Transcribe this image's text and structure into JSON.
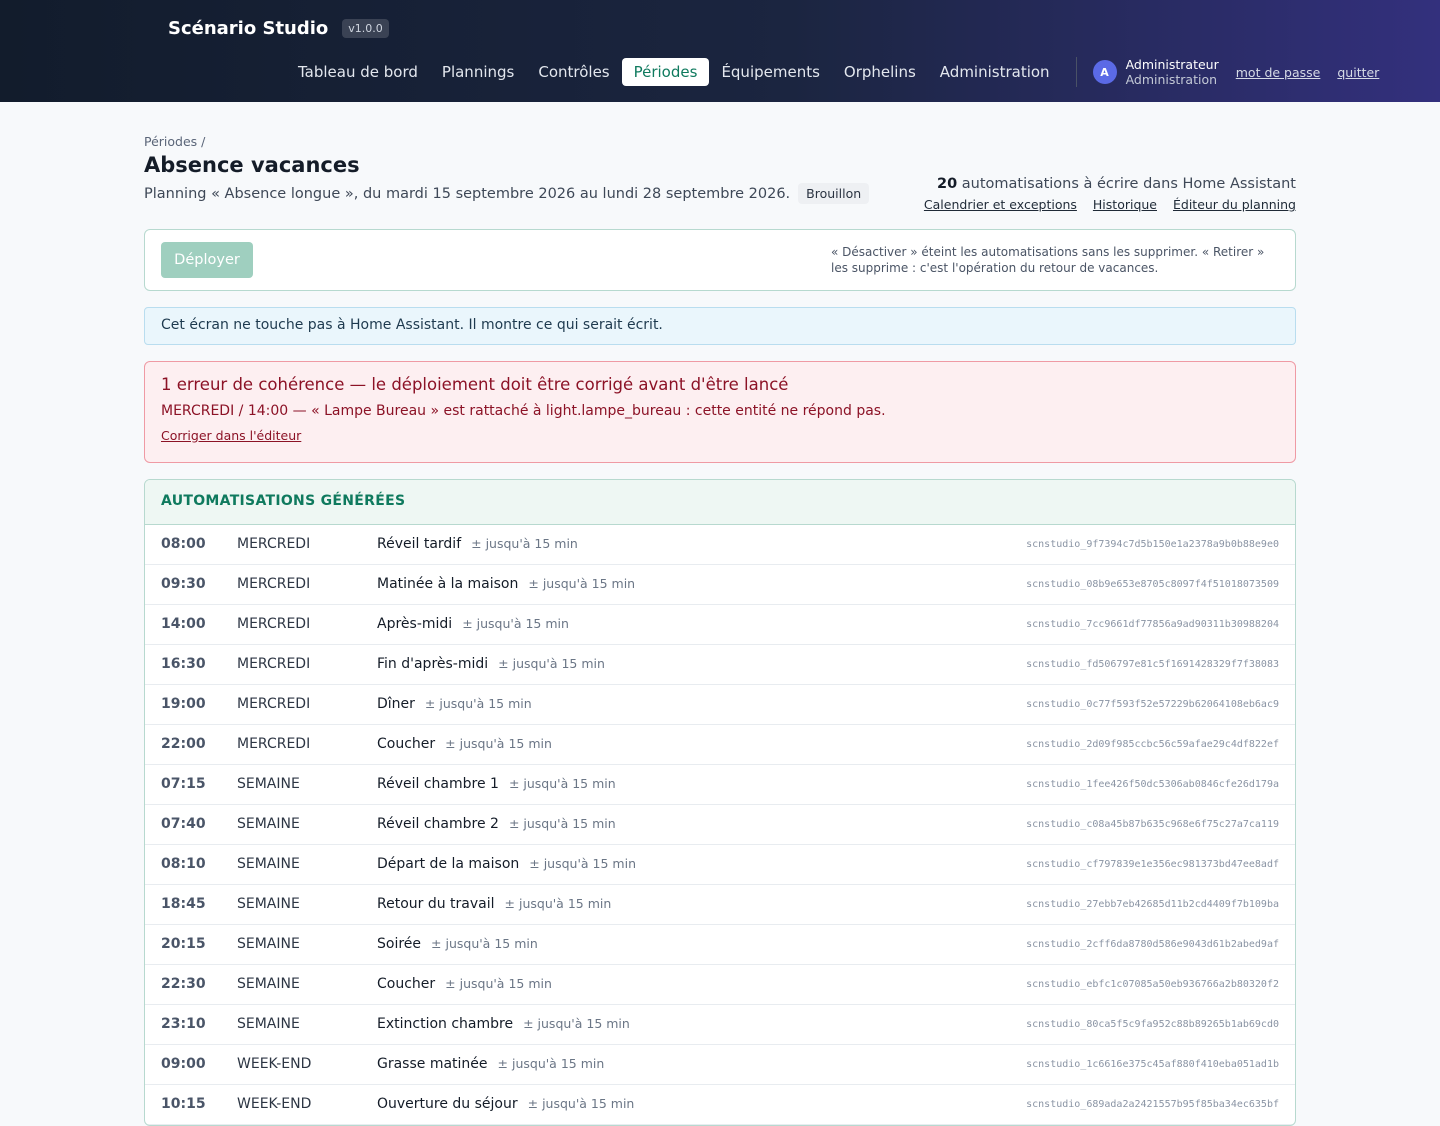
{
  "app": {
    "name": "Scénario Studio",
    "version": "v1.0.0"
  },
  "nav": [
    {
      "label": "Tableau de bord",
      "active": false
    },
    {
      "label": "Plannings",
      "active": false
    },
    {
      "label": "Contrôles",
      "active": false
    },
    {
      "label": "Périodes",
      "active": true
    },
    {
      "label": "Équipements",
      "active": false
    },
    {
      "label": "Orphelins",
      "active": false
    },
    {
      "label": "Administration",
      "active": false
    }
  ],
  "user": {
    "initial": "A",
    "name": "Administrateur",
    "role": "Administration",
    "password_link": "mot de passe",
    "logout_link": "quitter"
  },
  "page": {
    "breadcrumb": "Périodes /",
    "title": "Absence vacances",
    "subtitle": "Planning « Absence longue », du mardi 15 septembre 2026 au lundi 28 septembre 2026.",
    "status": "Brouillon",
    "count": "20",
    "count_text": "automatisations à écrire dans Home Assistant",
    "links": [
      "Calendrier et exceptions",
      "Historique",
      "Éditeur du planning"
    ]
  },
  "deploy": {
    "button": "Déployer",
    "note": "« Désactiver » éteint les automatisations sans les supprimer. « Retirer » les supprime : c'est l'opération du retour de vacances."
  },
  "info": "Cet écran ne touche pas à Home Assistant. Il montre ce qui serait écrit.",
  "error": {
    "title": "1 erreur de cohérence — le déploiement doit être corrigé avant d'être lancé",
    "detail": "MERCREDI / 14:00 — « Lampe Bureau » est rattaché à light.lampe_bureau : cette entité ne répond pas.",
    "link": "Corriger dans l'éditeur"
  },
  "table": {
    "heading": "AUTOMATISATIONS GÉNÉRÉES",
    "rows": [
      {
        "time": "08:00",
        "day": "MERCREDI",
        "name": "Réveil tardif",
        "jitter": "± jusqu'à 15 min",
        "id": "scnstudio_9f7394c7d5b150e1a2378a9b0b88e9e0"
      },
      {
        "time": "09:30",
        "day": "MERCREDI",
        "name": "Matinée à la maison",
        "jitter": "± jusqu'à 15 min",
        "id": "scnstudio_08b9e653e8705c8097f4f51018073509"
      },
      {
        "time": "14:00",
        "day": "MERCREDI",
        "name": "Après-midi",
        "jitter": "± jusqu'à 15 min",
        "id": "scnstudio_7cc9661df77856a9ad90311b30988204"
      },
      {
        "time": "16:30",
        "day": "MERCREDI",
        "name": "Fin d'après-midi",
        "jitter": "± jusqu'à 15 min",
        "id": "scnstudio_fd506797e81c5f1691428329f7f38083"
      },
      {
        "time": "19:00",
        "day": "MERCREDI",
        "name": "Dîner",
        "jitter": "± jusqu'à 15 min",
        "id": "scnstudio_0c77f593f52e57229b62064108eb6ac9"
      },
      {
        "time": "22:00",
        "day": "MERCREDI",
        "name": "Coucher",
        "jitter": "± jusqu'à 15 min",
        "id": "scnstudio_2d09f985ccbc56c59afae29c4df822ef"
      },
      {
        "time": "07:15",
        "day": "SEMAINE",
        "name": "Réveil chambre 1",
        "jitter": "± jusqu'à 15 min",
        "id": "scnstudio_1fee426f50dc5306ab0846cfe26d179a"
      },
      {
        "time": "07:40",
        "day": "SEMAINE",
        "name": "Réveil chambre 2",
        "jitter": "± jusqu'à 15 min",
        "id": "scnstudio_c08a45b87b635c968e6f75c27a7ca119"
      },
      {
        "time": "08:10",
        "day": "SEMAINE",
        "name": "Départ de la maison",
        "jitter": "± jusqu'à 15 min",
        "id": "scnstudio_cf797839e1e356ec981373bd47ee8adf"
      },
      {
        "time": "18:45",
        "day": "SEMAINE",
        "name": "Retour du travail",
        "jitter": "± jusqu'à 15 min",
        "id": "scnstudio_27ebb7eb42685d11b2cd4409f7b109ba"
      },
      {
        "time": "20:15",
        "day": "SEMAINE",
        "name": "Soirée",
        "jitter": "± jusqu'à 15 min",
        "id": "scnstudio_2cff6da8780d586e9043d61b2abed9af"
      },
      {
        "time": "22:30",
        "day": "SEMAINE",
        "name": "Coucher",
        "jitter": "± jusqu'à 15 min",
        "id": "scnstudio_ebfc1c07085a50eb936766a2b80320f2"
      },
      {
        "time": "23:10",
        "day": "SEMAINE",
        "name": "Extinction chambre",
        "jitter": "± jusqu'à 15 min",
        "id": "scnstudio_80ca5f5c9fa952c88b89265b1ab69cd0"
      },
      {
        "time": "09:00",
        "day": "WEEK-END",
        "name": "Grasse matinée",
        "jitter": "± jusqu'à 15 min",
        "id": "scnstudio_1c6616e375c45af880f410eba051ad1b"
      },
      {
        "time": "10:15",
        "day": "WEEK-END",
        "name": "Ouverture du séjour",
        "jitter": "± jusqu'à 15 min",
        "id": "scnstudio_689ada2a2421557b95f85ba34ec635bf"
      }
    ]
  }
}
